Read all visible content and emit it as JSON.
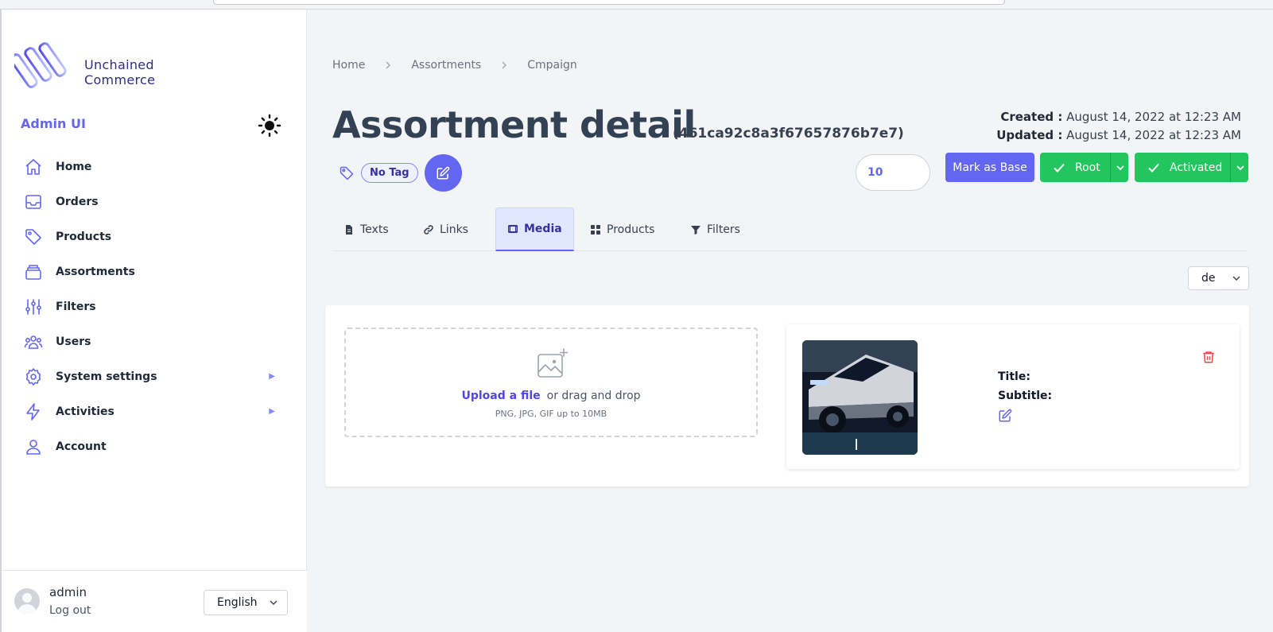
{
  "app": {
    "logo_text_line1": "Unchained",
    "logo_text_line2": "Commerce",
    "section_title": "Admin UI"
  },
  "sidebar": {
    "items": [
      {
        "label": "Home",
        "icon": "home-icon"
      },
      {
        "label": "Orders",
        "icon": "inbox-icon"
      },
      {
        "label": "Products",
        "icon": "tag-icon"
      },
      {
        "label": "Assortments",
        "icon": "stack-icon"
      },
      {
        "label": "Filters",
        "icon": "sliders-icon"
      },
      {
        "label": "Users",
        "icon": "users-icon"
      },
      {
        "label": "System settings",
        "icon": "gear-icon",
        "expandable": true
      },
      {
        "label": "Activities",
        "icon": "bolt-icon",
        "expandable": true
      },
      {
        "label": "Account",
        "icon": "user-icon"
      }
    ],
    "footer": {
      "user_name": "admin",
      "logout_label": "Log out",
      "language": "English"
    }
  },
  "breadcrumb": [
    "Home",
    "Assortments",
    "Cmpaign"
  ],
  "header": {
    "title": "Assortment detail",
    "id": "(461ca92c8a3f67657876b7e7)",
    "created_label": "Created :",
    "created_value": "August 14, 2022 at 12:23 AM",
    "updated_label": "Updated :",
    "updated_value": "August 14, 2022 at 12:23 AM"
  },
  "tags": {
    "tag_label": "No Tag"
  },
  "toolbar": {
    "sequence_value": "10",
    "mark_base_label": "Mark as Base",
    "root_label": "Root",
    "activated_label": "Activated"
  },
  "tabs": [
    {
      "label": "Texts",
      "icon": "document-icon"
    },
    {
      "label": "Links",
      "icon": "link-icon"
    },
    {
      "label": "Media",
      "icon": "film-icon",
      "active": true
    },
    {
      "label": "Products",
      "icon": "grid-icon"
    },
    {
      "label": "Filters",
      "icon": "funnel-icon"
    }
  ],
  "locale": {
    "selected": "de"
  },
  "media": {
    "upload_link": "Upload a file",
    "upload_rest": "or drag and drop",
    "upload_hint": "PNG, JPG, GIF up to 10MB",
    "title_label": "Title:",
    "subtitle_label": "Subtitle:"
  },
  "colors": {
    "accent": "#6366f1",
    "success": "#22c55e",
    "danger": "#ef4444"
  }
}
